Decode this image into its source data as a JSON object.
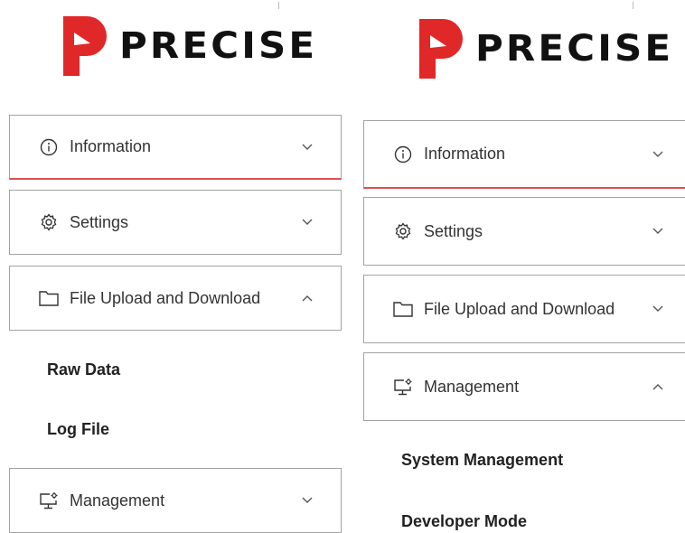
{
  "brand": {
    "name": "PRECISE",
    "accent": "#d9534f",
    "logo_red": "#e02828"
  },
  "left_panel": {
    "menu": [
      {
        "label": "Information",
        "icon": "info-icon",
        "expanded": false,
        "active": true
      },
      {
        "label": "Settings",
        "icon": "gear-icon",
        "expanded": false,
        "active": false
      },
      {
        "label": "File Upload and Download",
        "icon": "folder-icon",
        "expanded": true,
        "active": false
      },
      {
        "label": "Management",
        "icon": "monitor-gear-icon",
        "expanded": false,
        "active": false
      }
    ],
    "submenu": [
      "Raw Data",
      "Log File"
    ]
  },
  "right_panel": {
    "menu": [
      {
        "label": "Information",
        "icon": "info-icon",
        "expanded": false,
        "active": true
      },
      {
        "label": "Settings",
        "icon": "gear-icon",
        "expanded": false,
        "active": false
      },
      {
        "label": "File Upload and Download",
        "icon": "folder-icon",
        "expanded": false,
        "active": false
      },
      {
        "label": "Management",
        "icon": "monitor-gear-icon",
        "expanded": true,
        "active": false
      }
    ],
    "submenu": [
      "System Management",
      "Developer Mode"
    ]
  }
}
